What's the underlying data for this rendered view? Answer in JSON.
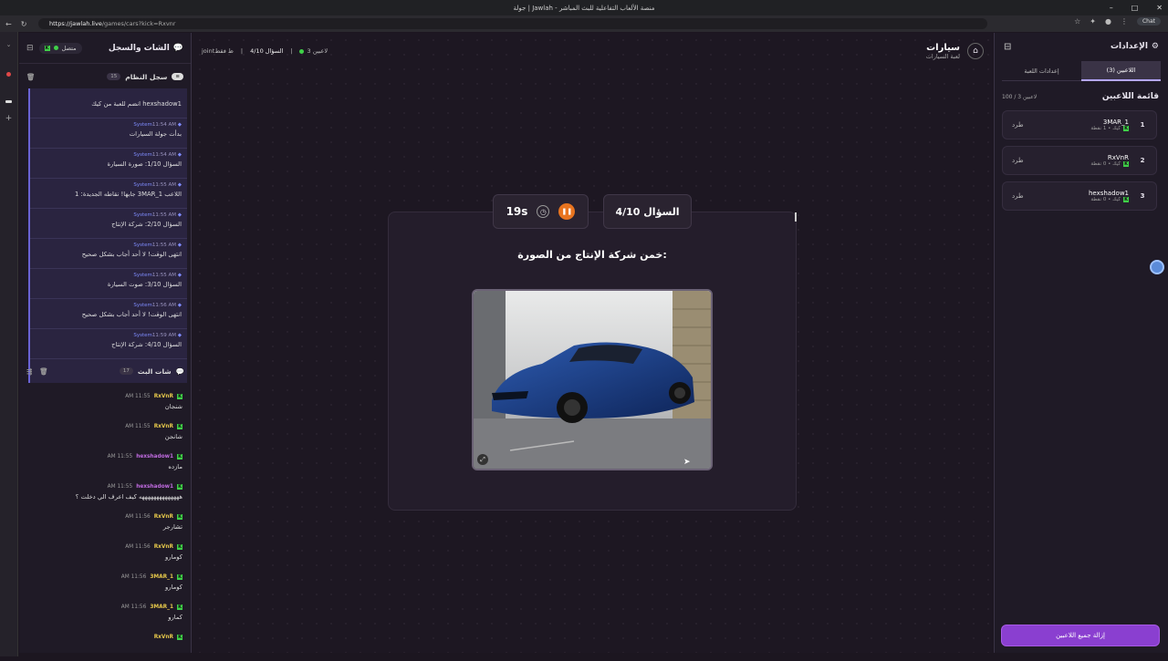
{
  "browser": {
    "tab_title": "جولة | Jawlah - منصة الألعاب التفاعلية للبث المباشر",
    "url_host": "https://jawlah.live",
    "url_path": "/games/cars?kick=Rxvnr",
    "chat_label": "Chat"
  },
  "left_panel": {
    "title": "الشات والسجل",
    "status": "متصل",
    "system_log": {
      "title": "سجل النظام",
      "count": "15",
      "items": [
        {
          "who": "",
          "time": "",
          "text": "hexshadow1 انضم للعبة من كيك"
        },
        {
          "who": "System",
          "time": "11:54 AM",
          "text": "بدأت جولة السيارات"
        },
        {
          "who": "System",
          "time": "11:54 AM",
          "text": "السؤال 1/10: صورة السيارة"
        },
        {
          "who": "System",
          "time": "11:55 AM",
          "text": "اللاعب 3MAR_1 جابها! نقاطه الجديدة: 1"
        },
        {
          "who": "System",
          "time": "11:55 AM",
          "text": "السؤال 2/10: شركة الإنتاج"
        },
        {
          "who": "System",
          "time": "11:55 AM",
          "text": "انتهى الوقت! لا أحد أجاب بشكل صحيح"
        },
        {
          "who": "System",
          "time": "11:55 AM",
          "text": "السؤال 3/10: صوت السيارة"
        },
        {
          "who": "System",
          "time": "11:56 AM",
          "text": "انتهى الوقت! لا أحد أجاب بشكل صحيح"
        },
        {
          "who": "System",
          "time": "11:59 AM",
          "text": "السؤال 4/10: شركة الإنتاج"
        }
      ]
    },
    "live_chat": {
      "title": "شات البث",
      "count": "17",
      "items": [
        {
          "who": "RxVnR",
          "time": "11:55 AM",
          "text": "شنجان",
          "color": "#e6c84a"
        },
        {
          "who": "RxVnR",
          "time": "11:55 AM",
          "text": "شانجن",
          "color": "#e6c84a"
        },
        {
          "who": "hexshadow1",
          "time": "11:55 AM",
          "text": "مازده",
          "color": "#c06be0"
        },
        {
          "who": "hexshadow1",
          "time": "11:55 AM",
          "text": "ههههههههههههههه كيف اعرف الي دخلت ؟",
          "color": "#c06be0"
        },
        {
          "who": "RxVnR",
          "time": "11:56 AM",
          "text": "تشارجر",
          "color": "#e6c84a"
        },
        {
          "who": "RxVnR",
          "time": "11:56 AM",
          "text": "كومارو",
          "color": "#e6c84a"
        },
        {
          "who": "3MAR_1",
          "time": "11:56 AM",
          "text": "كومارو",
          "color": "#e6c84a"
        },
        {
          "who": "3MAR_1",
          "time": "11:56 AM",
          "text": "كمارو",
          "color": "#e6c84a"
        },
        {
          "who": "RxVnR",
          "time": "",
          "text": "",
          "color": "#e6c84a"
        }
      ]
    }
  },
  "main": {
    "game_name": "سيارات",
    "game_sub": "لعبة السيارات",
    "players_count": "3 لاعبين",
    "round": "السؤال 4/10",
    "mode": "jointظ فقط",
    "timer": "19s",
    "question_box": "السؤال 4/10",
    "question": "خمن شركة الإنتاج من الصورة:"
  },
  "right_panel": {
    "title": "الإعدادات",
    "tabs": [
      "اللاعبين (3)",
      "إعدادات اللعبة"
    ],
    "players_title": "قائمة اللاعبين",
    "players_count": "100 / 3 لاعبين",
    "kick_label": "طرد",
    "players": [
      {
        "rank": "1",
        "name": "3MAR_1",
        "sub": "كيك • 1 نقطة"
      },
      {
        "rank": "2",
        "name": "RxVnR",
        "sub": "كيك • 0 نقطة"
      },
      {
        "rank": "3",
        "name": "hexshadow1",
        "sub": "كيك • 0 نقطة"
      }
    ],
    "remove_all": "إزالة جميع اللاعبين"
  },
  "colors": {
    "accent": "#8a3fd0",
    "kick_green": "#3fd048",
    "online": "#3fd048"
  }
}
